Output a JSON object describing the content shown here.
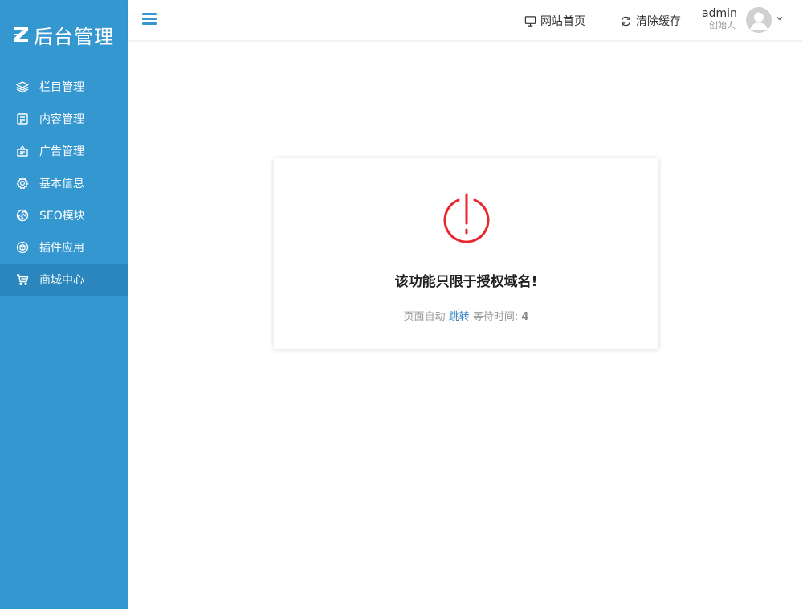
{
  "sidebar": {
    "logo_text": "后台管理",
    "items": [
      {
        "label": "栏目管理",
        "icon": "layers-icon"
      },
      {
        "label": "内容管理",
        "icon": "document-icon"
      },
      {
        "label": "广告管理",
        "icon": "ad-icon"
      },
      {
        "label": "基本信息",
        "icon": "gear-icon"
      },
      {
        "label": "SEO模块",
        "icon": "link-icon"
      },
      {
        "label": "插件应用",
        "icon": "cube-icon"
      },
      {
        "label": "商城中心",
        "icon": "cart-icon"
      }
    ],
    "active_index": 6
  },
  "header": {
    "home_label": "网站首页",
    "clear_cache_label": "清除缓存",
    "user_name": "admin",
    "user_role": "创始人"
  },
  "message": {
    "title": "该功能只限于授权域名!",
    "sub_prefix": "页面自动",
    "jump_label": "跳转",
    "wait_label": "等待时间:",
    "countdown": "4"
  },
  "colors": {
    "sidebar_bg": "#3497d0",
    "sidebar_active": "#2a86bd",
    "accent": "#3497d0",
    "power_icon": "#e8262b",
    "link": "#2c7bbd"
  }
}
